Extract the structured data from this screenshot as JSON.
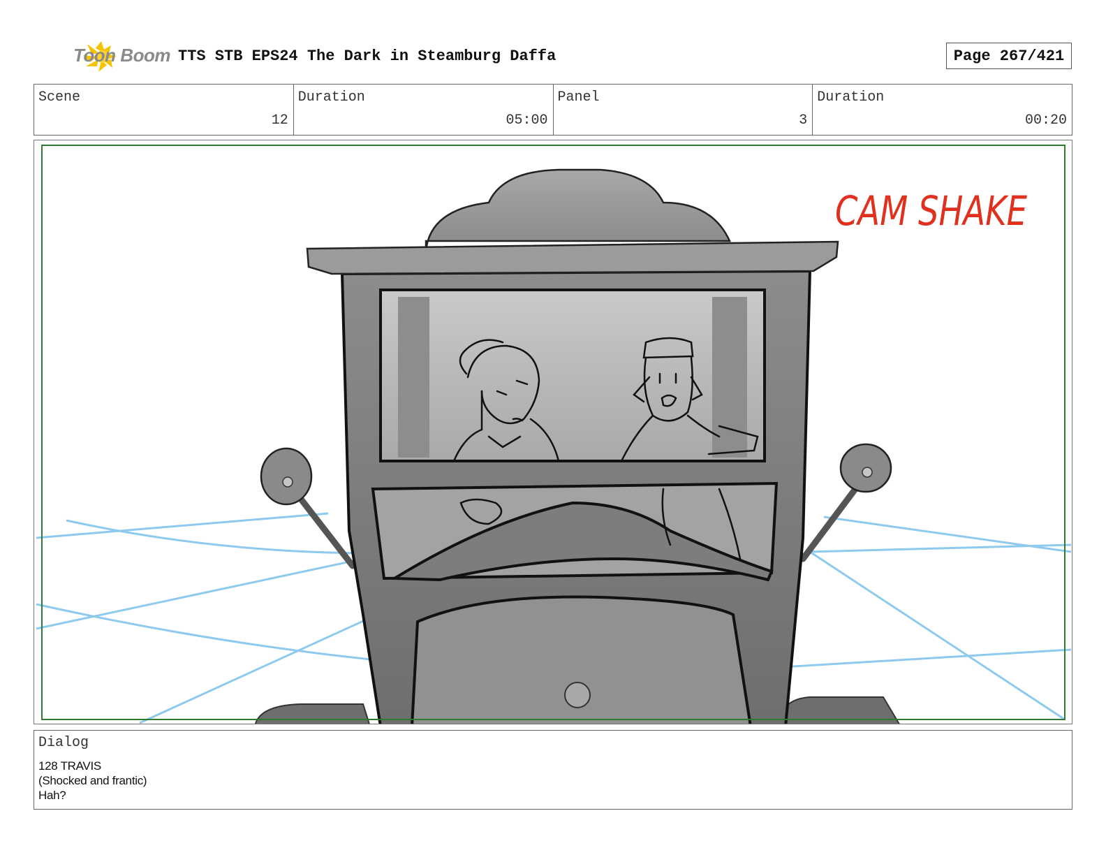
{
  "header": {
    "logo_text": "Toon Boom",
    "title": "TTS STB EPS24 The Dark in Steamburg Daffa",
    "page": "Page 267/421"
  },
  "info": {
    "scene_label": "Scene",
    "scene_value": "12",
    "scene_duration_label": "Duration",
    "scene_duration_value": "05:00",
    "panel_label": "Panel",
    "panel_value": "3",
    "panel_duration_label": "Duration",
    "panel_duration_value": "00:20"
  },
  "panel": {
    "annotation": "CAM SHAKE",
    "annotation_color": "#e0301e",
    "frame_color": "#2f7a2f",
    "motion_line_color": "#8ec9ee"
  },
  "dialog": {
    "label": "Dialog",
    "lines": [
      "128 TRAVIS",
      "(Shocked and frantic)",
      "Hah?"
    ]
  }
}
